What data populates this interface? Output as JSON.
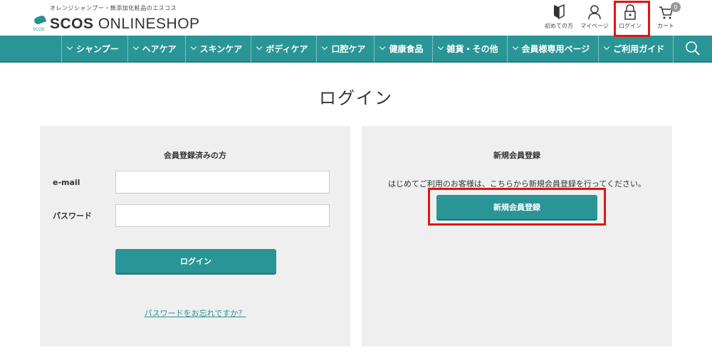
{
  "header": {
    "tagline": "オレンジシャンプー・無添加化粧品のエスコス",
    "logo_small": "SCOS",
    "logo_bold": "SCOS",
    "logo_rest": " ONLINESHOP",
    "util": {
      "first_time": "初めての方",
      "mypage": "マイページ",
      "login": "ログイン",
      "cart": "カート",
      "cart_count": "0"
    }
  },
  "nav": {
    "items": [
      {
        "label": "シャンプー"
      },
      {
        "label": "ヘアケア"
      },
      {
        "label": "スキンケア"
      },
      {
        "label": "ボディケア"
      },
      {
        "label": "口腔ケア"
      },
      {
        "label": "健康食品"
      },
      {
        "label": "雑貨・その他"
      },
      {
        "label": "会員様専用ページ"
      },
      {
        "label": "ご利用ガイド"
      }
    ]
  },
  "page": {
    "title": "ログイン"
  },
  "member": {
    "title": "会員登録済みの方",
    "email_label": "e-mail",
    "email_value": "",
    "password_label": "パスワード",
    "password_value": "",
    "login_button": "ログイン",
    "forgot_link": "パスワードをお忘れですか？"
  },
  "register": {
    "title": "新規会員登録",
    "text": "はじめてご利用のお客様は、こちらから新規会員登録を行ってください。",
    "button": "新規会員登録"
  },
  "colors": {
    "accent": "#2a9596",
    "highlight": "#e01515",
    "panel_bg": "#efefef"
  }
}
